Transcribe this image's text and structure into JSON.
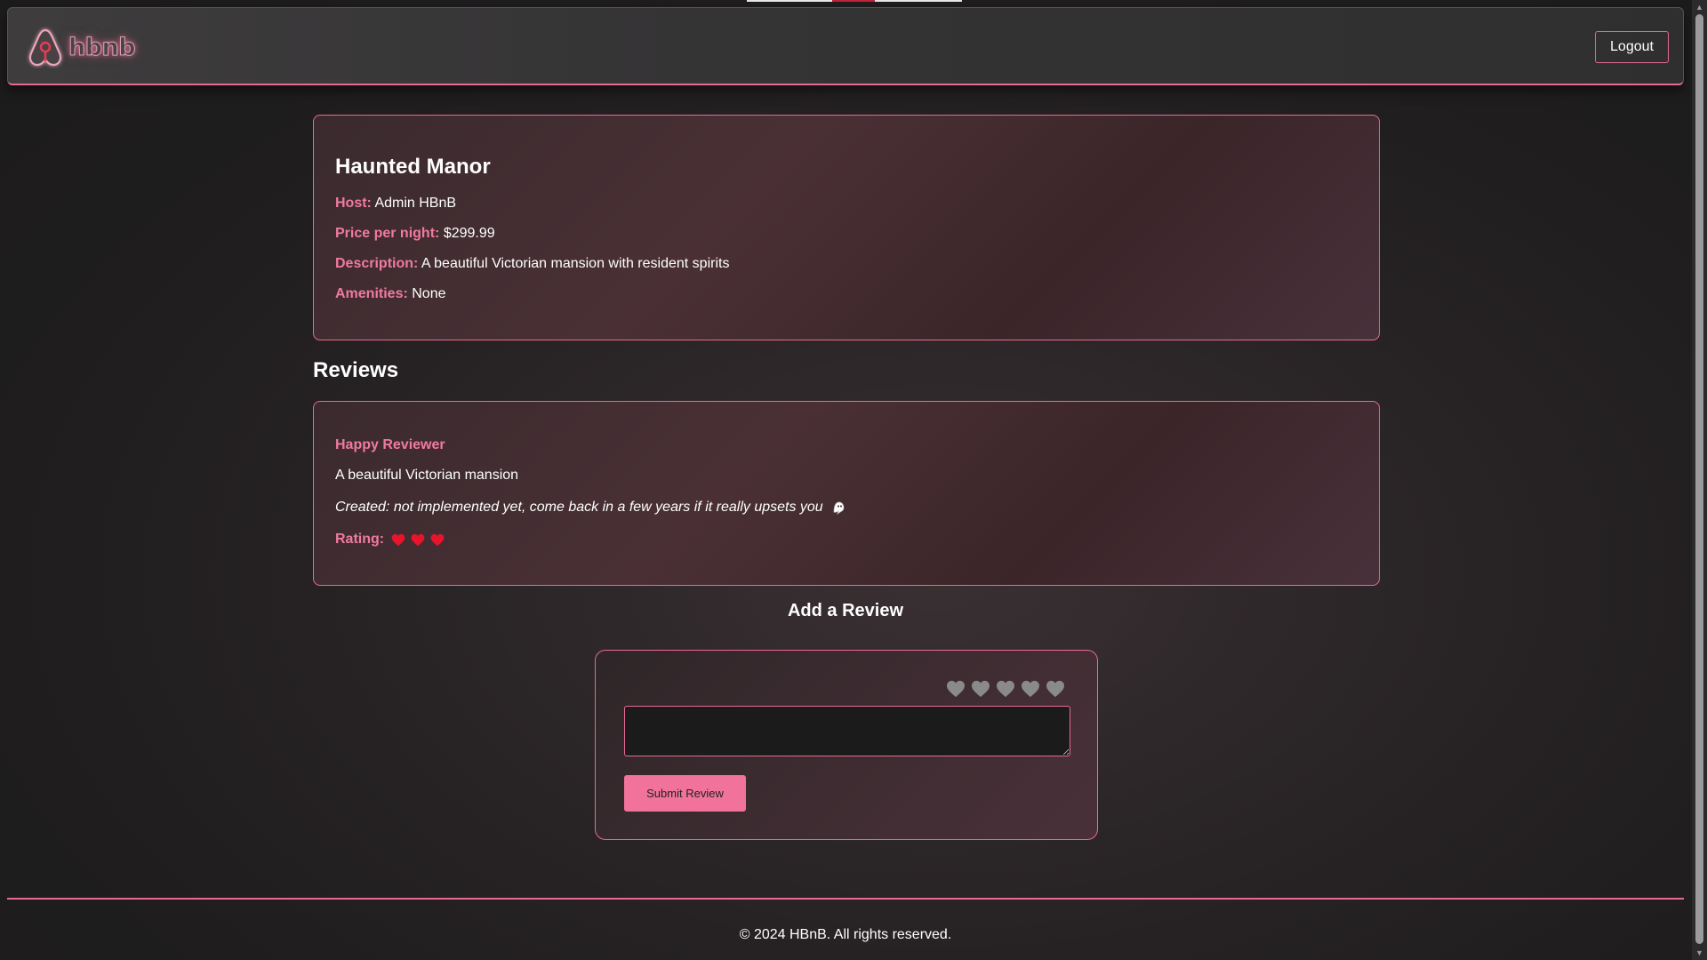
{
  "header": {
    "logo_text": "hbnb",
    "logout_label": "Logout"
  },
  "place": {
    "title": "Haunted Manor",
    "host_label": "Host:",
    "host_value": "Admin HBnB",
    "price_label": "Price per night:",
    "price_value": "$299.99",
    "description_label": "Description:",
    "description_value": "A beautiful Victorian mansion with resident spirits",
    "amenities_label": "Amenities:",
    "amenities_value": "None"
  },
  "reviews": {
    "heading": "Reviews",
    "items": [
      {
        "reviewer": "Happy Reviewer",
        "text": "A beautiful Victorian mansion",
        "created": "Created: not implemented yet, come back in a few years if it really upsets you",
        "created_icon": "ghost-icon",
        "rating_label": "Rating:",
        "rating": 3
      }
    ]
  },
  "add_review": {
    "heading": "Add a Review",
    "rating_max": 5,
    "rating_selected": 0,
    "text_value": "",
    "submit_label": "Submit Review"
  },
  "footer": {
    "text": "© 2024 HBnB. All rights reserved."
  },
  "colors": {
    "accent": "#e86a92",
    "label": "#f07aa0",
    "heart_filled": "#e8142c",
    "heart_empty": "#8a8a8a",
    "submit_bg": "#f1729a"
  }
}
